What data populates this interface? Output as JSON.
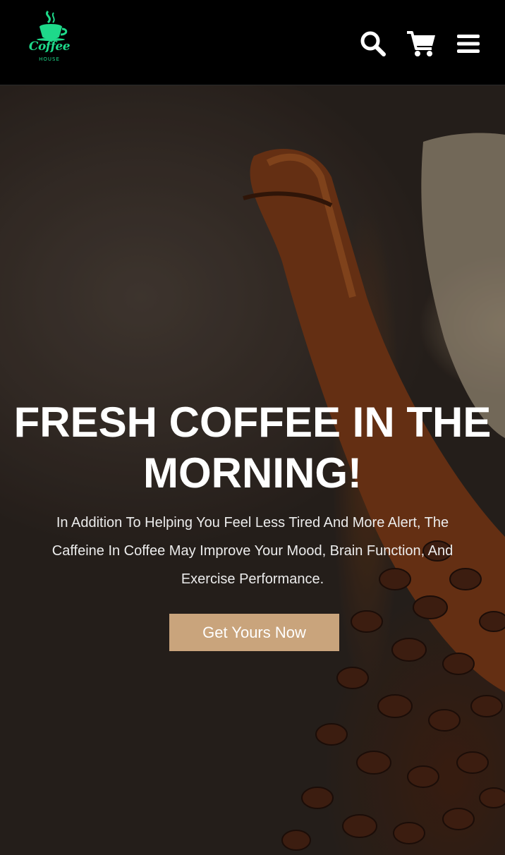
{
  "header": {
    "logo": {
      "text": "Coffee",
      "subtext": "HOUSE",
      "icon": "coffee-cup-logo-icon",
      "color": "#1ed98a"
    },
    "icons": [
      "search-icon",
      "cart-icon",
      "menu-icon"
    ]
  },
  "hero": {
    "title": "FRESH COFFEE IN THE MORNING!",
    "description": "In Addition To Helping You Feel Less Tired And More Alert, The Caffeine In Coffee May Improve Your Mood, Brain Function, And Exercise Performance.",
    "cta_label": "Get Yours Now",
    "cta_color": "#c9a47c"
  }
}
